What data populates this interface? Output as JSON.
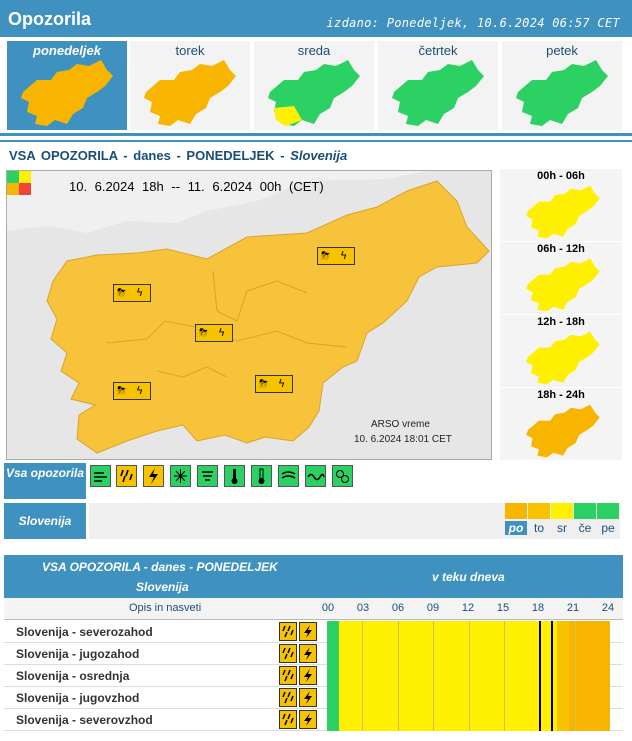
{
  "header": {
    "title": "Opozorila",
    "issued": "izdano: Ponedeljek, 10.6.2024 06:57 CET"
  },
  "days": [
    {
      "label": "ponedeljek",
      "level": "orange",
      "active": true
    },
    {
      "label": "torek",
      "level": "orange",
      "active": false
    },
    {
      "label": "sreda",
      "level": "green",
      "active": false
    },
    {
      "label": "četrtek",
      "level": "green",
      "active": false
    },
    {
      "label": "petek",
      "level": "green",
      "active": false
    }
  ],
  "section": {
    "part1": "VSA OPOZORILA",
    "sep1": "-",
    "part2": "danes",
    "sep2": "-",
    "part3": "PONEDELJEK",
    "sep3": "-",
    "part4": "Slovenija"
  },
  "map": {
    "period": "10. 6.2024  18h  --  11. 6.2024  00h     (CET)",
    "credit": "ARSO vreme",
    "date": "10. 6.2024  18:01 CET"
  },
  "timeslots": [
    {
      "label": "00h - 06h",
      "level": "yellow"
    },
    {
      "label": "06h - 12h",
      "level": "yellow"
    },
    {
      "label": "12h - 18h",
      "level": "yellow"
    },
    {
      "label": "18h - 24h",
      "level": "orange"
    }
  ],
  "icons_bar": {
    "label": "Vsa opozorila",
    "icons": [
      "wind-icon",
      "rain-icon",
      "thunderstorm-icon",
      "snow-icon",
      "ice-icon",
      "heat-icon",
      "cold-icon",
      "fog-icon",
      "coastal-icon",
      "fire-icon"
    ]
  },
  "region_bar": {
    "label": "Slovenija"
  },
  "levels": [
    {
      "code": "po",
      "color": "#f7b500",
      "selected": true
    },
    {
      "code": "to",
      "color": "#f7c200",
      "selected": false
    },
    {
      "code": "sr",
      "color": "#ffef00",
      "selected": false
    },
    {
      "code": "če",
      "color": "#2bd163",
      "selected": false
    },
    {
      "code": "pe",
      "color": "#2bd163",
      "selected": false
    }
  ],
  "table": {
    "title": "VSA OPOZORILA - danes - PONEDELJEK",
    "subtitle": "Slovenija",
    "right_title": "v teku dneva",
    "col_opis": "Opis in nasveti",
    "hours": [
      "00",
      "03",
      "06",
      "09",
      "12",
      "15",
      "18",
      "21",
      "24"
    ],
    "rows": [
      {
        "name": "Slovenija - severozahod"
      },
      {
        "name": "Slovenija - jugozahod"
      },
      {
        "name": "Slovenija - osrednja"
      },
      {
        "name": "Slovenija - jugovzhod"
      },
      {
        "name": "Slovenija - severovzhod"
      }
    ],
    "timeline": [
      {
        "from": 0,
        "to": 1,
        "level": "green"
      },
      {
        "from": 1,
        "to": 19.5,
        "level": "yellow"
      },
      {
        "from": 19.5,
        "to": 20.5,
        "level": "orange-light"
      },
      {
        "from": 20.5,
        "to": 24,
        "level": "orange"
      }
    ],
    "now_markers": [
      18,
      19
    ]
  },
  "colors": {
    "header": "#3f91bf",
    "green": "#2bd163",
    "yellow": "#ffef00",
    "orange": "#f7b500",
    "orange-light": "#f7c200"
  }
}
